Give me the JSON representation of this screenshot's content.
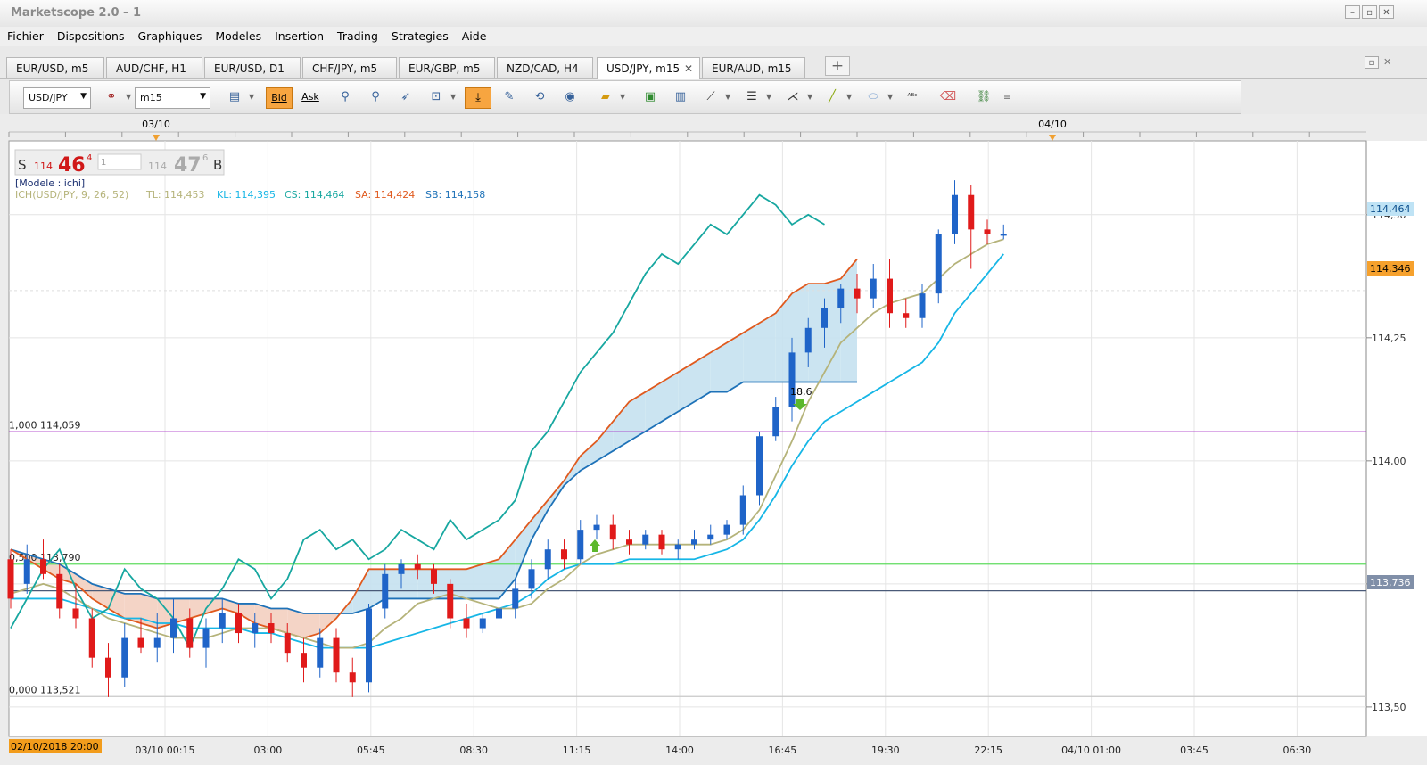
{
  "window": {
    "title": "Marketscope 2.0 – 1"
  },
  "menu": [
    "Fichier",
    "Dispositions",
    "Graphiques",
    "Modeles",
    "Insertion",
    "Trading",
    "Strategies",
    "Aide"
  ],
  "tabs": [
    "EUR/USD, m5",
    "AUD/CHF, H1",
    "EUR/USD, D1",
    "CHF/JPY, m5",
    "EUR/GBP, m5",
    "NZD/CAD, H4",
    "USD/JPY, m15",
    "EUR/AUD, m15"
  ],
  "active_tab": "USD/JPY, m15",
  "toolbar": {
    "symbol": "USD/JPY",
    "timeframe": "m15",
    "bid_label": "Bid",
    "ask_label": "Ask"
  },
  "quote": {
    "sell_label": "S",
    "sell_big": "114",
    "sell_pips": "46",
    "sell_frac": "4",
    "amount": "1",
    "buy_big": "114",
    "buy_pips": "47",
    "buy_frac": "6",
    "buy_label": "B"
  },
  "model_label": "[Modele : ichi]",
  "indicator_legend": [
    {
      "text": "ICH(USD/JPY, 9, 26, 52)",
      "color": "#b5b37a"
    },
    {
      "text": "TL: 114,453",
      "color": "#b5b37a"
    },
    {
      "text": "KL: 114,395",
      "color": "#16b6e6"
    },
    {
      "text": "CS: 114,464",
      "color": "#17a7a0"
    },
    {
      "text": "SA: 114,424",
      "color": "#e05a1e"
    },
    {
      "text": "SB: 114,158",
      "color": "#1e72b8"
    }
  ],
  "top_dates": [
    "03/10",
    "04/10"
  ],
  "price_axis": [
    "114,50",
    "114,25",
    "114,00",
    "113,75",
    "113,50"
  ],
  "price_tags": [
    {
      "text": "114,464",
      "bg": "#bfe3f5",
      "color": "#0a4d8c"
    },
    {
      "text": "114,346",
      "bg": "#f6a12d",
      "color": "#000000"
    },
    {
      "text": "113,736",
      "bg": "#808fa8",
      "color": "#ffffff"
    }
  ],
  "fib_labels": [
    "1,000 114,059",
    "0,500 113,790",
    "0,000 113,521"
  ],
  "time_axis": [
    "03/10 00:15",
    "03:00",
    "05:45",
    "08:30",
    "11:15",
    "14:00",
    "16:45",
    "19:30",
    "22:15",
    "04/10 01:00",
    "03:45",
    "06:30"
  ],
  "time_axis_start": "02/10/2018 20:00",
  "signal_label": "18,6",
  "colors": {
    "up": "#1f64c8",
    "down": "#e01a1a",
    "tenkan": "#b5b37a",
    "kijun": "#16b6e6",
    "chikou": "#17a7a0",
    "senkou_a": "#e05a1e",
    "senkou_b": "#1e72b8",
    "cloud_up": "#c5e1f0",
    "cloud_down": "#f3cfc0",
    "fib_top": "#a020c0",
    "fib_mid": "#5fdc5f"
  },
  "chart_data": {
    "type": "candlestick",
    "symbol": "USD/JPY",
    "timeframe": "m15",
    "ylim": [
      113.44,
      114.65
    ],
    "candles": [
      [
        113.8,
        113.82,
        113.7,
        113.72
      ],
      [
        113.75,
        113.83,
        113.73,
        113.8
      ],
      [
        113.8,
        113.84,
        113.76,
        113.77
      ],
      [
        113.77,
        113.79,
        113.68,
        113.7
      ],
      [
        113.7,
        113.75,
        113.66,
        113.68
      ],
      [
        113.68,
        113.7,
        113.58,
        113.6
      ],
      [
        113.6,
        113.63,
        113.52,
        113.56
      ],
      [
        113.56,
        113.67,
        113.54,
        113.64
      ],
      [
        113.64,
        113.68,
        113.61,
        113.62
      ],
      [
        113.62,
        113.69,
        113.59,
        113.64
      ],
      [
        113.64,
        113.72,
        113.61,
        113.68
      ],
      [
        113.68,
        113.7,
        113.6,
        113.62
      ],
      [
        113.62,
        113.68,
        113.58,
        113.66
      ],
      [
        113.66,
        113.72,
        113.63,
        113.69
      ],
      [
        113.69,
        113.71,
        113.63,
        113.65
      ],
      [
        113.65,
        113.69,
        113.62,
        113.67
      ],
      [
        113.67,
        113.69,
        113.63,
        113.65
      ],
      [
        113.65,
        113.67,
        113.59,
        113.61
      ],
      [
        113.61,
        113.64,
        113.55,
        113.58
      ],
      [
        113.58,
        113.66,
        113.56,
        113.64
      ],
      [
        113.64,
        113.66,
        113.55,
        113.57
      ],
      [
        113.57,
        113.6,
        113.52,
        113.55
      ],
      [
        113.55,
        113.71,
        113.53,
        113.7
      ],
      [
        113.7,
        113.79,
        113.68,
        113.77
      ],
      [
        113.77,
        113.8,
        113.74,
        113.79
      ],
      [
        113.79,
        113.81,
        113.76,
        113.78
      ],
      [
        113.78,
        113.79,
        113.73,
        113.75
      ],
      [
        113.75,
        113.76,
        113.66,
        113.68
      ],
      [
        113.68,
        113.71,
        113.64,
        113.66
      ],
      [
        113.66,
        113.69,
        113.65,
        113.68
      ],
      [
        113.68,
        113.71,
        113.66,
        113.7
      ],
      [
        113.7,
        113.76,
        113.68,
        113.74
      ],
      [
        113.74,
        113.8,
        113.72,
        113.78
      ],
      [
        113.78,
        113.84,
        113.76,
        113.82
      ],
      [
        113.82,
        113.84,
        113.78,
        113.8
      ],
      [
        113.8,
        113.88,
        113.79,
        113.86
      ],
      [
        113.86,
        113.89,
        113.84,
        113.87
      ],
      [
        113.87,
        113.89,
        113.82,
        113.84
      ],
      [
        113.84,
        113.86,
        113.81,
        113.83
      ],
      [
        113.83,
        113.86,
        113.82,
        113.85
      ],
      [
        113.85,
        113.86,
        113.81,
        113.82
      ],
      [
        113.82,
        113.84,
        113.8,
        113.83
      ],
      [
        113.83,
        113.86,
        113.82,
        113.84
      ],
      [
        113.84,
        113.87,
        113.83,
        113.85
      ],
      [
        113.85,
        113.88,
        113.84,
        113.87
      ],
      [
        113.87,
        113.95,
        113.85,
        113.93
      ],
      [
        113.93,
        114.06,
        113.91,
        114.05
      ],
      [
        114.05,
        114.13,
        114.04,
        114.11
      ],
      [
        114.11,
        114.25,
        114.08,
        114.22
      ],
      [
        114.22,
        114.29,
        114.19,
        114.27
      ],
      [
        114.27,
        114.33,
        114.23,
        114.31
      ],
      [
        114.31,
        114.36,
        114.28,
        114.35
      ],
      [
        114.35,
        114.38,
        114.3,
        114.33
      ],
      [
        114.33,
        114.4,
        114.31,
        114.37
      ],
      [
        114.37,
        114.41,
        114.27,
        114.3
      ],
      [
        114.3,
        114.33,
        114.27,
        114.29
      ],
      [
        114.29,
        114.36,
        114.27,
        114.34
      ],
      [
        114.34,
        114.47,
        114.32,
        114.46
      ],
      [
        114.46,
        114.57,
        114.44,
        114.54
      ],
      [
        114.54,
        114.56,
        114.39,
        114.47
      ],
      [
        114.47,
        114.49,
        114.44,
        114.46
      ],
      [
        114.46,
        114.48,
        114.45,
        114.46
      ]
    ],
    "tenkan": [
      113.73,
      113.74,
      113.75,
      113.74,
      113.72,
      113.7,
      113.68,
      113.67,
      113.66,
      113.65,
      113.64,
      113.64,
      113.64,
      113.65,
      113.66,
      113.66,
      113.66,
      113.65,
      113.64,
      113.63,
      113.62,
      113.62,
      113.63,
      113.66,
      113.68,
      113.71,
      113.72,
      113.73,
      113.72,
      113.71,
      113.7,
      113.7,
      113.71,
      113.74,
      113.76,
      113.79,
      113.81,
      113.82,
      113.83,
      113.83,
      113.83,
      113.83,
      113.83,
      113.83,
      113.84,
      113.86,
      113.9,
      113.97,
      114.04,
      114.12,
      114.18,
      114.24,
      114.27,
      114.3,
      114.32,
      114.33,
      114.34,
      114.37,
      114.4,
      114.42,
      114.44,
      114.45
    ],
    "kijun": [
      113.72,
      113.72,
      113.72,
      113.72,
      113.71,
      113.7,
      113.69,
      113.68,
      113.68,
      113.67,
      113.67,
      113.66,
      113.66,
      113.66,
      113.66,
      113.65,
      113.65,
      113.64,
      113.63,
      113.62,
      113.62,
      113.62,
      113.62,
      113.63,
      113.64,
      113.65,
      113.66,
      113.67,
      113.68,
      113.69,
      113.7,
      113.71,
      113.73,
      113.76,
      113.78,
      113.79,
      113.79,
      113.79,
      113.8,
      113.8,
      113.8,
      113.8,
      113.8,
      113.81,
      113.82,
      113.84,
      113.88,
      113.93,
      113.99,
      114.04,
      114.08,
      114.1,
      114.12,
      114.14,
      114.16,
      114.18,
      114.2,
      114.24,
      114.3,
      114.34,
      114.38,
      114.42
    ],
    "chikou": [
      113.66,
      113.72,
      113.78,
      113.82,
      113.74,
      113.68,
      113.7,
      113.78,
      113.74,
      113.72,
      113.68,
      113.62,
      113.7,
      113.74,
      113.8,
      113.78,
      113.72,
      113.76,
      113.84,
      113.86,
      113.82,
      113.84,
      113.8,
      113.82,
      113.86,
      113.84,
      113.82,
      113.88,
      113.84,
      113.86,
      113.88,
      113.92,
      114.02,
      114.06,
      114.12,
      114.18,
      114.22,
      114.26,
      114.32,
      114.38,
      114.42,
      114.4,
      114.44,
      114.48,
      114.46,
      114.5,
      114.54,
      114.52,
      114.48,
      114.5,
      114.48
    ],
    "senkou_a": [
      113.82,
      113.8,
      113.78,
      113.76,
      113.75,
      113.72,
      113.7,
      113.68,
      113.67,
      113.66,
      113.67,
      113.68,
      113.69,
      113.7,
      113.69,
      113.67,
      113.66,
      113.65,
      113.64,
      113.65,
      113.68,
      113.72,
      113.78,
      113.78,
      113.78,
      113.78,
      113.78,
      113.78,
      113.78,
      113.79,
      113.8,
      113.84,
      113.88,
      113.92,
      113.96,
      114.01,
      114.04,
      114.08,
      114.12,
      114.14,
      114.16,
      114.18,
      114.2,
      114.22,
      114.24,
      114.26,
      114.28,
      114.3,
      114.34,
      114.36,
      114.36,
      114.37,
      114.41
    ],
    "senkou_b": [
      113.82,
      113.81,
      113.8,
      113.79,
      113.77,
      113.75,
      113.74,
      113.73,
      113.73,
      113.72,
      113.72,
      113.72,
      113.72,
      113.72,
      113.71,
      113.71,
      113.7,
      113.7,
      113.69,
      113.69,
      113.69,
      113.69,
      113.7,
      113.72,
      113.72,
      113.72,
      113.72,
      113.72,
      113.72,
      113.72,
      113.72,
      113.76,
      113.84,
      113.9,
      113.95,
      113.98,
      114.0,
      114.02,
      114.04,
      114.06,
      114.08,
      114.1,
      114.12,
      114.14,
      114.14,
      114.16,
      114.16,
      114.16,
      114.16,
      114.16,
      114.16,
      114.16,
      114.16
    ],
    "fib_levels": [
      {
        "label": "1,000 114,059",
        "value": 114.059
      },
      {
        "label": "0,500 113,790",
        "value": 113.79
      },
      {
        "label": "0,000 113,521",
        "value": 113.521
      }
    ],
    "horizontal_lines": [
      113.736,
      114.346
    ],
    "yticks": [
      114.5,
      114.25,
      114.0,
      113.75,
      113.5
    ],
    "xticks": [
      "03/10 00:15",
      "03:00",
      "05:45",
      "08:30",
      "11:15",
      "14:00",
      "16:45",
      "19:30",
      "22:15",
      "04/10 01:00",
      "03:45",
      "06:30"
    ]
  }
}
